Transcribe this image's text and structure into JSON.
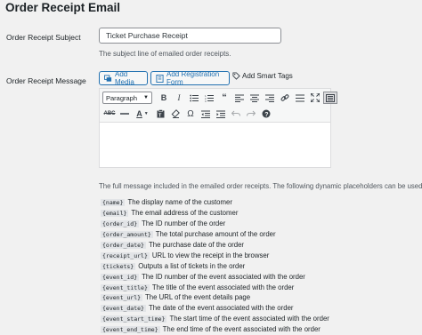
{
  "section": {
    "title": "Order Receipt Email"
  },
  "subject": {
    "label": "Order Receipt Subject",
    "value": "Ticket Purchase Receipt",
    "description": "The subject line of emailed order receipts."
  },
  "message": {
    "label": "Order Receipt Message",
    "buttons": {
      "add_media": "Add Media",
      "add_registration_form": "Add Registration Form",
      "add_smart_tags": "Add Smart Tags"
    },
    "toolbar": {
      "format_select": "Paragraph",
      "row1_icons": [
        "bold-icon",
        "italic-icon",
        "bulleted-list-icon",
        "numbered-list-icon",
        "blockquote-icon",
        "align-left-icon",
        "align-center-icon",
        "align-right-icon",
        "link-icon",
        "unlink-icon",
        "fullscreen-icon",
        "toolbar-toggle-icon"
      ],
      "row2_icons": [
        "strikethrough-icon",
        "horizontal-rule-icon",
        "text-color-icon",
        "paste-as-text-icon",
        "clear-formatting-icon",
        "special-character-icon",
        "outdent-icon",
        "indent-icon",
        "undo-icon",
        "redo-icon",
        "help-icon"
      ]
    },
    "description": "The full message included in the emailed order receipts. The following dynamic placeholders can be used:",
    "placeholders": [
      {
        "tag": "{name}",
        "text": "The display name of the customer"
      },
      {
        "tag": "{email}",
        "text": "The email address of the customer"
      },
      {
        "tag": "{order_id}",
        "text": "The ID number of the order"
      },
      {
        "tag": "{order_amount}",
        "text": "The total purchase amount of the order"
      },
      {
        "tag": "{order_date}",
        "text": "The purchase date of the order"
      },
      {
        "tag": "{receipt_url}",
        "text": "URL to view the receipt in the browser"
      },
      {
        "tag": "{tickets}",
        "text": "Outputs a list of tickets in the order"
      },
      {
        "tag": "{event_id}",
        "text": "The ID number of the event associated with the order"
      },
      {
        "tag": "{event_title}",
        "text": "The title of the event associated with the order"
      },
      {
        "tag": "{event_url}",
        "text": "The URL of the event details page"
      },
      {
        "tag": "{event_date}",
        "text": "The date of the event associated with the order"
      },
      {
        "tag": "{event_start_time}",
        "text": "The start time of the event associated with the order"
      },
      {
        "tag": "{event_end_time}",
        "text": "The end time of the event associated with the order"
      }
    ]
  },
  "colors": {
    "accent": "#2271b1",
    "background": "#f1f1f1",
    "text": "#1d2327"
  }
}
